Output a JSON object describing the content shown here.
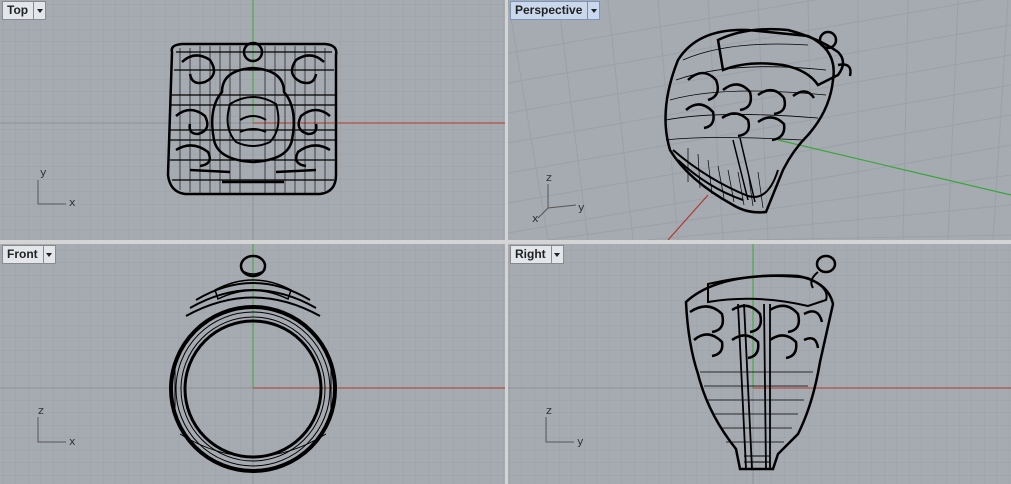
{
  "viewports": {
    "top": {
      "label": "Top",
      "axes": {
        "h": "x",
        "v": "y"
      }
    },
    "perspective": {
      "label": "Perspective",
      "axes": {
        "h": "y",
        "v": "z",
        "d": "x"
      }
    },
    "front": {
      "label": "Front",
      "axes": {
        "h": "x",
        "v": "z"
      }
    },
    "right": {
      "label": "Right",
      "axes": {
        "h": "y",
        "v": "z"
      }
    }
  },
  "colors": {
    "viewport_bg": "#a6aab1",
    "grid_minor": "#9ca0a7",
    "grid_major": "#8e9299",
    "x_axis": "#b03a2e",
    "y_axis": "#3aa63a",
    "wire": "#000000",
    "active_tab": "#c9d8ec"
  }
}
